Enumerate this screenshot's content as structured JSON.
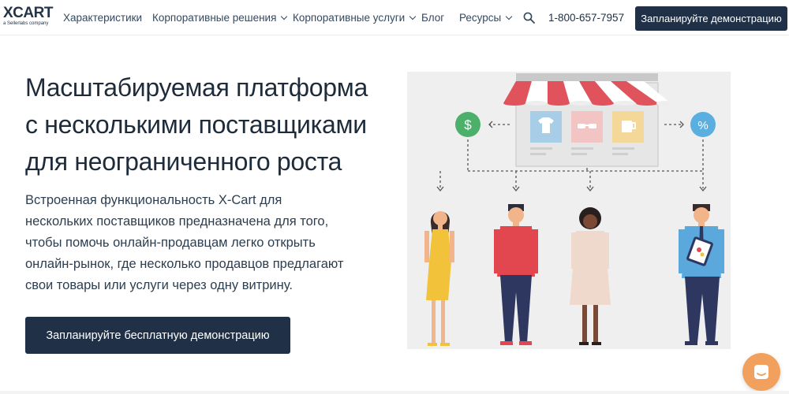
{
  "header": {
    "logo_text": "XCART",
    "logo_sub": "a Sellerlabs company",
    "nav": [
      {
        "label": "Характеристики",
        "dropdown": false
      },
      {
        "label": "Корпоративные решения",
        "dropdown": true
      },
      {
        "label": "Корпоративные услуги",
        "dropdown": true
      },
      {
        "label": "Блог",
        "dropdown": false
      },
      {
        "label": "Ресурсы",
        "dropdown": true
      }
    ],
    "search_icon": "search-icon",
    "phone": "1-800-657-7957",
    "demo_button": "Запланируйте демонстрацию"
  },
  "hero": {
    "title_lines": [
      "Масштабируемая платформа",
      "с несколькими поставщиками",
      "для неограниченного роста"
    ],
    "description_lines": [
      "Встроенная функциональность X-Cart для",
      "нескольких поставщиков предназначена для того,",
      "чтобы помочь онлайн-продавцам легко открыть",
      "онлайн-рынок, где несколько продавцов предлагают",
      "свои товары или услуги через одну витрину."
    ],
    "cta_button": "Запланируйте бесплатную демонстрацию"
  },
  "illustration": {
    "dollar_symbol": "$",
    "percent_symbol": "%"
  },
  "colors": {
    "primary": "#1f3047",
    "chat": "#f2a05e",
    "awning_red": "#e0525c"
  }
}
